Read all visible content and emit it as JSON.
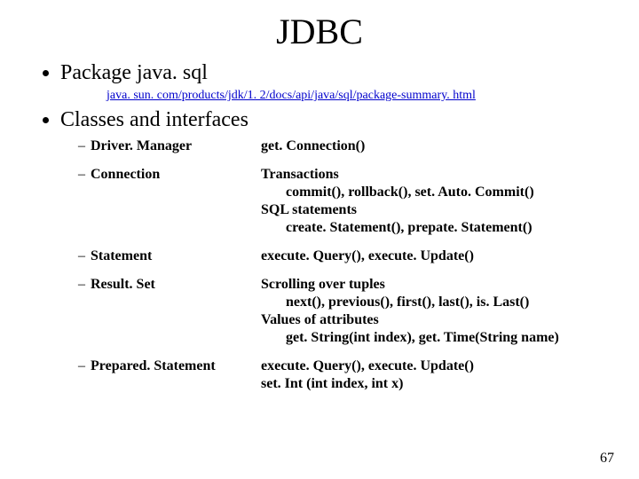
{
  "title": "JDBC",
  "bullets": {
    "pkg": "Package java. sql",
    "link": "java. sun. com/products/jdk/1. 2/docs/api/java/sql/package-summary. html",
    "classes_label": "Classes and interfaces"
  },
  "rows": [
    {
      "name": "Driver. Manager",
      "lines": [
        "get. Connection()"
      ]
    },
    {
      "name": "Connection",
      "lines": [
        "Transactions",
        {
          "sub": "commit(), rollback(), set. Auto. Commit()"
        },
        "SQL statements",
        {
          "sub": "create. Statement(), prepate. Statement()"
        }
      ]
    },
    {
      "name": "Statement",
      "lines": [
        "execute. Query(), execute. Update()"
      ]
    },
    {
      "name": "Result. Set",
      "lines": [
        "Scrolling over tuples",
        {
          "sub": "next(), previous(), first(), last(), is. Last()"
        },
        "Values of attributes",
        {
          "sub": "get. String(int index), get. Time(String name)"
        }
      ]
    },
    {
      "name": "Prepared. Statement",
      "lines": [
        "execute. Query(), execute. Update()",
        "set. Int (int index, int x)"
      ]
    }
  ],
  "page_number": "67"
}
